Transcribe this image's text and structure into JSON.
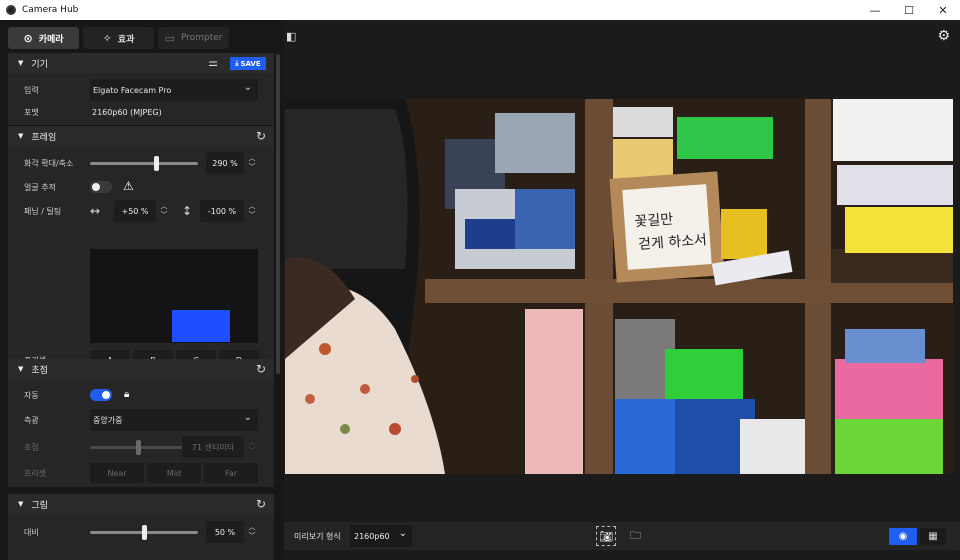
{
  "window": {
    "title": "Camera Hub",
    "minimize": "—",
    "maximize": "☐",
    "close": "✕"
  },
  "tabs": [
    {
      "label": "카메라",
      "icon": "camera-icon"
    },
    {
      "label": "효과",
      "icon": "magic-wand-icon"
    },
    {
      "label": "Prompter",
      "icon": "prompter-icon"
    }
  ],
  "device": {
    "title": "기기",
    "save_label": "SAVE",
    "input_label": "입력",
    "input_value": "Elgato Facecam Pro",
    "format_label": "포맷",
    "format_value": "2160p60 (MJPEG)"
  },
  "frame": {
    "title": "프레임",
    "zoom_label": "화각 확대/축소",
    "zoom_value": "290 %",
    "zoom_level": 0.62,
    "face_track_label": "얼굴 추적",
    "pan_tilt_label": "패닝 / 틸팅",
    "pan_value": "+50 %",
    "tilt_value": "-100 %",
    "preset_label": "프리셋",
    "presets": [
      "A",
      "B",
      "C",
      "D"
    ]
  },
  "focus": {
    "title": "초점",
    "auto_label": "자동",
    "metering_label": "측광",
    "metering_value": "중앙가중",
    "focus_label": "초점",
    "focus_value": "71 센티미터",
    "focus_level": 0.45,
    "preset_label": "프리셋",
    "presets": [
      "Near",
      "Mid",
      "Far"
    ]
  },
  "picture": {
    "title": "그림",
    "contrast_label": "대비",
    "contrast_value": "50 %",
    "contrast_level": 0.5
  },
  "bottom": {
    "preview_format_label": "미리보기 형식",
    "preview_format_value": "2160p60"
  },
  "colors": {
    "accent": "#1f5ef0",
    "pad_rect": "#1d4fff"
  }
}
